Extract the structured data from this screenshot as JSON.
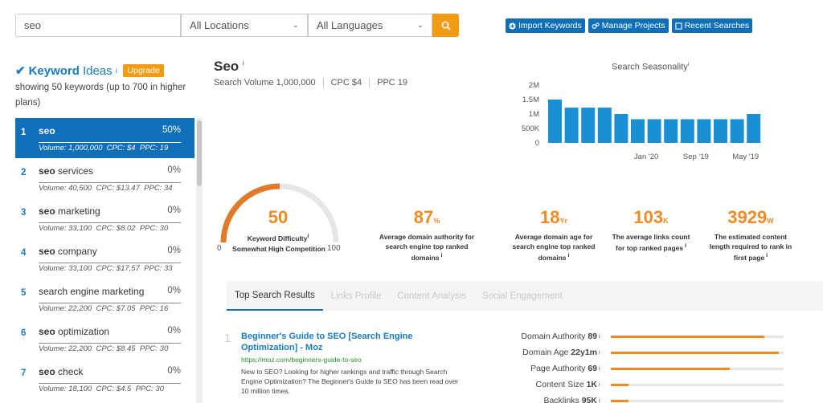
{
  "search": {
    "query": "seo",
    "location": "All Locations",
    "language": "All Languages"
  },
  "actions": {
    "import": "Import Keywords",
    "manage": "Manage Projects",
    "recent": "Recent Searches"
  },
  "left": {
    "title_bold": "Keyword",
    "title_rest": "Ideas",
    "upgrade": "Upgrade",
    "subtitle": "showing 50 keywords (up to 700 in higher plans)",
    "keywords": [
      {
        "num": "1",
        "bold": "seo",
        "rest": "",
        "pct": "50%",
        "meta": "Volume: 1,000,000  CPC: $4  PPC: 19",
        "active": true
      },
      {
        "num": "2",
        "bold": "seo",
        "rest": " services",
        "pct": "0%",
        "meta": "Volume: 40,500  CPC: $13.47  PPC: 34"
      },
      {
        "num": "3",
        "bold": "seo",
        "rest": " marketing",
        "pct": "0%",
        "meta": "Volume: 33,100  CPC: $8.02  PPC: 30"
      },
      {
        "num": "4",
        "bold": "seo",
        "rest": " company",
        "pct": "0%",
        "meta": "Volume: 33,100  CPC: $17.57  PPC: 33"
      },
      {
        "num": "5",
        "bold": "",
        "rest": "search engine marketing",
        "pct": "0%",
        "meta": "Volume: 22,200  CPC: $7.05  PPC: 16"
      },
      {
        "num": "6",
        "bold": "seo",
        "rest": " optimization",
        "pct": "0%",
        "meta": "Volume: 22,200  CPC: $8.45  PPC: 30"
      },
      {
        "num": "7",
        "bold": "seo",
        "rest": " check",
        "pct": "0%",
        "meta": "Volume: 18,100  CPC: $4.5  PPC: 30"
      }
    ]
  },
  "main": {
    "title": "Seo",
    "stats": [
      "Search Volume 1,000,000",
      "CPC $4",
      "PPC 19"
    ]
  },
  "season": {
    "title": "Search Seasonality"
  },
  "chart_data": {
    "type": "bar",
    "title": "Search Seasonality",
    "y_ticks": [
      "2M",
      "1.5M",
      "1M",
      "500K",
      "0"
    ],
    "ylim": [
      0,
      2000000
    ],
    "values": [
      1500000,
      1220000,
      1220000,
      1220000,
      1000000,
      820000,
      820000,
      820000,
      820000,
      820000,
      820000,
      820000,
      1000000
    ],
    "x_tick_labels": [
      {
        "index": 6,
        "label": "Jan '20"
      },
      {
        "index": 9,
        "label": "Sep '19"
      },
      {
        "index": 12,
        "label": "May '19"
      }
    ],
    "color": "#1a8fd6"
  },
  "difficulty": {
    "value": 50,
    "label": "Keyword Difficulty",
    "sub": "Somewhat High Competition",
    "min": "0",
    "max": "100",
    "color": "#e07b2a"
  },
  "metrics": [
    {
      "val": "87",
      "unit": "%",
      "desc": "Average domain authority for search engine top ranked domains"
    },
    {
      "val": "18",
      "unit": "Yr",
      "desc": "Average domain age for search engine top ranked domains"
    },
    {
      "val": "103",
      "unit": "K",
      "desc": "The average links count for top ranked pages"
    },
    {
      "val": "3929",
      "unit": "W",
      "desc": "The estimated content length required to rank in first page"
    }
  ],
  "tabs": [
    "Top Search Results",
    "Links Profile",
    "Content Analysis",
    "Social Engagement"
  ],
  "result": {
    "num": "1",
    "title": "Beginner's Guide to SEO [Search Engine Optimization] - Moz",
    "url": "https://moz.com/beginners-guide-to-seo",
    "desc": "New to SEO? Looking for higher rankings and traffic through Search Engine Optimization? The Beginner's Guide to SEO has been read over 10 million times."
  },
  "result_metrics": [
    {
      "label": "Domain Authority",
      "value": "89",
      "fraction": 0.89
    },
    {
      "label": "Domain Age",
      "value": "22y1m",
      "fraction": 0.97
    },
    {
      "label": "Page Authority",
      "value": "69",
      "fraction": 0.69
    },
    {
      "label": "Content Size",
      "value": "1K",
      "fraction": 0.1
    },
    {
      "label": "Backlinks",
      "value": "95K",
      "fraction": 0.1
    }
  ]
}
